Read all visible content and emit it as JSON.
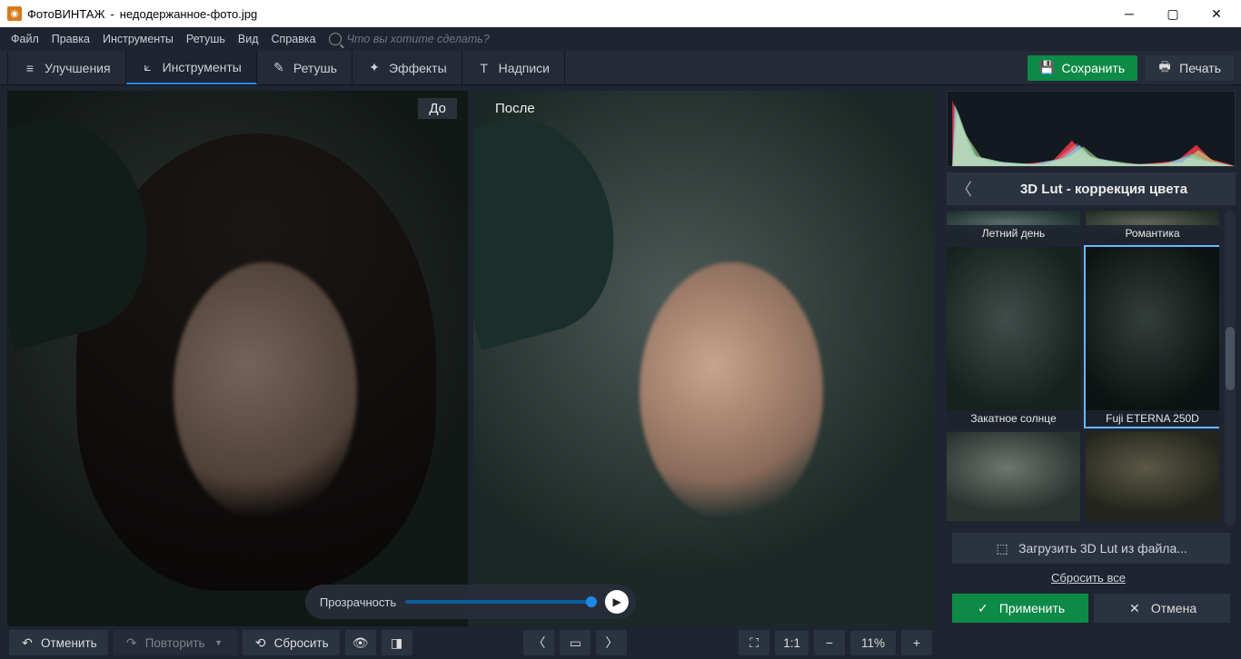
{
  "titlebar": {
    "app": "ФотоВИНТАЖ",
    "filename": "недодержанное-фото.jpg"
  },
  "menu": {
    "file": "Файл",
    "edit": "Правка",
    "tools": "Инструменты",
    "retouch": "Ретушь",
    "view": "Вид",
    "help": "Справка",
    "search_ph": "Что вы хотите сделать?"
  },
  "tabs": {
    "enhance": "Улучшения",
    "tools": "Инструменты",
    "retouch": "Ретушь",
    "effects": "Эффекты",
    "text": "Надписи"
  },
  "header_btns": {
    "save": "Сохранить",
    "print": "Печать"
  },
  "compare": {
    "before": "До",
    "after": "После",
    "transparency": "Прозрачность"
  },
  "bottom": {
    "undo": "Отменить",
    "redo": "Повторить",
    "reset": "Сбросить",
    "zoom": "11%",
    "ratio": "1:1"
  },
  "panel": {
    "title": "3D Lut - коррекция цвета"
  },
  "presets": {
    "summer": "Летний день",
    "romance": "Романтика",
    "sunset": "Закатное солнце",
    "fuji": "Fuji ETERNA 250D"
  },
  "sidebar_actions": {
    "load_lut": "Загрузить 3D Lut из файла...",
    "reset_all": "Сбросить все",
    "apply": "Применить",
    "cancel": "Отмена"
  }
}
